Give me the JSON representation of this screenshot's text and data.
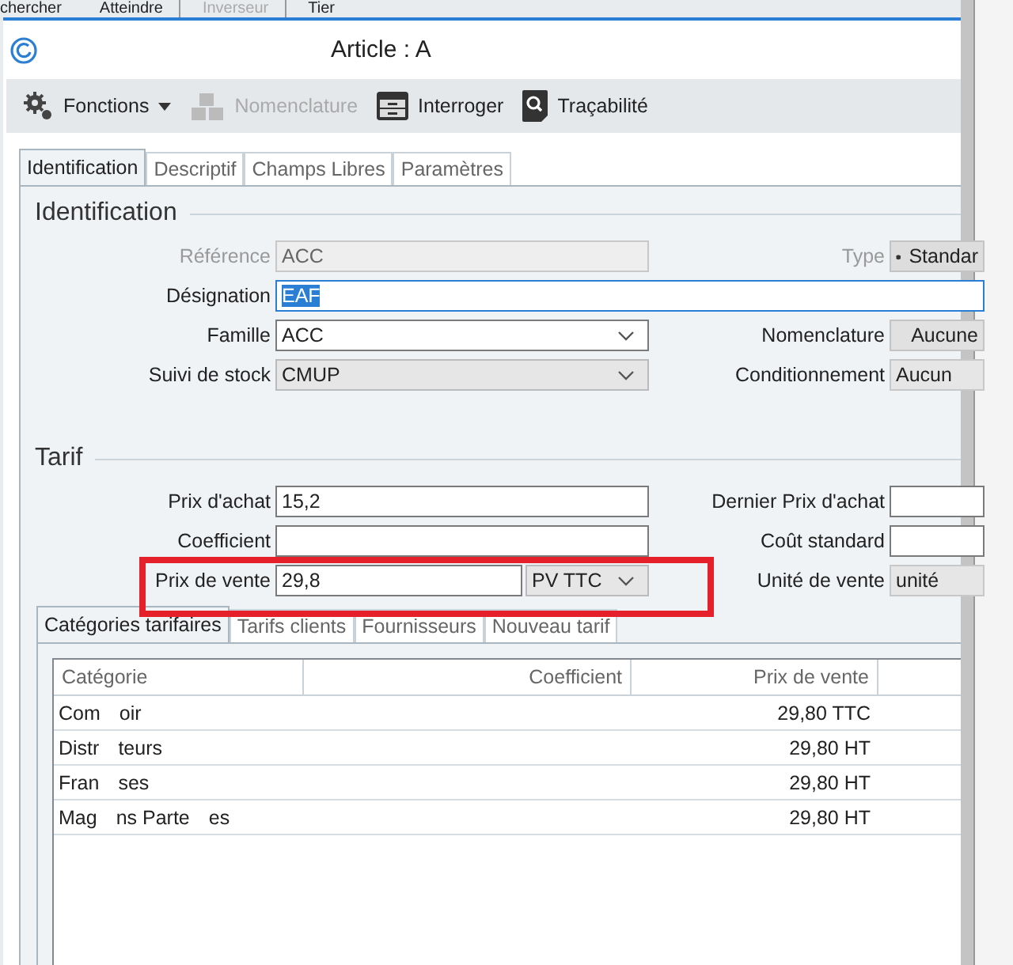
{
  "menu": [
    {
      "label": "chercher",
      "disabled": false
    },
    {
      "label": "Atteindre",
      "disabled": false
    },
    {
      "label": "Inverseur",
      "disabled": true
    },
    {
      "label": "Tier",
      "disabled": false
    }
  ],
  "window": {
    "title": "Article : A"
  },
  "toolbar": [
    {
      "label": "Fonctions",
      "disabled": false,
      "dropdown": true
    },
    {
      "label": "Nomenclature",
      "disabled": true,
      "dropdown": false
    },
    {
      "label": "Interroger",
      "disabled": false,
      "dropdown": false
    },
    {
      "label": "Traçabilité",
      "disabled": false,
      "dropdown": false
    }
  ],
  "tabs": [
    {
      "label": "Identification",
      "selected": true
    },
    {
      "label": "Descriptif",
      "selected": false
    },
    {
      "label": "Champs Libres",
      "selected": false
    },
    {
      "label": "Paramètres",
      "selected": false
    }
  ],
  "sections": [
    {
      "title": "Identification",
      "rows": [
        {
          "left": {
            "label": "Référence",
            "value": "ACC",
            "kind": "readonly",
            "disabled": true
          },
          "right": {
            "label": "Type",
            "value": "Standar",
            "kind": "picker",
            "disabled": true
          }
        },
        {
          "left": {
            "label": "Désignation",
            "value": "EAF",
            "kind": "wide",
            "disabled": false,
            "selected": true
          }
        },
        {
          "left": {
            "label": "Famille",
            "value": "ACC",
            "kind": "combo",
            "disabled": false
          },
          "right": {
            "label": "Nomenclature",
            "value": "Aucune",
            "kind": "button",
            "disabled": false
          }
        },
        {
          "left": {
            "label": "Suivi de stock",
            "value": "CMUP",
            "kind": "graycombo",
            "disabled": false
          },
          "right": {
            "label": "Conditionnement",
            "value": "Aucun",
            "kind": "readonly",
            "disabled": false
          }
        }
      ]
    },
    {
      "title": "Tarif",
      "rows": [
        {
          "left": {
            "label": "Prix d'achat",
            "value": "15,2",
            "kind": "text",
            "disabled": false
          },
          "right": {
            "label": "Dernier Prix d'achat",
            "kind": "text",
            "disabled": false
          }
        },
        {
          "left": {
            "label": "Coefficient",
            "kind": "text",
            "disabled": false
          },
          "right": {
            "label": "Coût standard",
            "kind": "text",
            "disabled": false
          }
        },
        {
          "highlighted": true,
          "left": {
            "label": "Prix de vente",
            "value": "29,8",
            "kind": "price",
            "unit": "PV TTC",
            "disabled": false
          },
          "right": {
            "label": "Unité de vente",
            "value": "unité",
            "kind": "readonly",
            "disabled": false
          }
        }
      ]
    }
  ],
  "subtabs": [
    {
      "label": "Catégories tarifaires",
      "selected": true
    },
    {
      "label": "Tarifs clients",
      "selected": false
    },
    {
      "label": "Fournisseurs",
      "selected": false
    },
    {
      "label": "Nouveau tarif",
      "selected": false
    }
  ],
  "table": {
    "columns": [
      "Catégorie",
      "Coefficient",
      "Prix de vente"
    ],
    "rows": [
      {
        "category": [
          "Com",
          "oir"
        ],
        "price": "29,80 TTC"
      },
      {
        "category": [
          "Distr",
          "teurs"
        ],
        "price": "29,80 HT"
      },
      {
        "category": [
          "Fran",
          "ses"
        ],
        "price": "29,80 HT"
      },
      {
        "category": [
          "Mag",
          "ns Parte",
          "es"
        ],
        "price": "29,80 HT"
      }
    ]
  }
}
